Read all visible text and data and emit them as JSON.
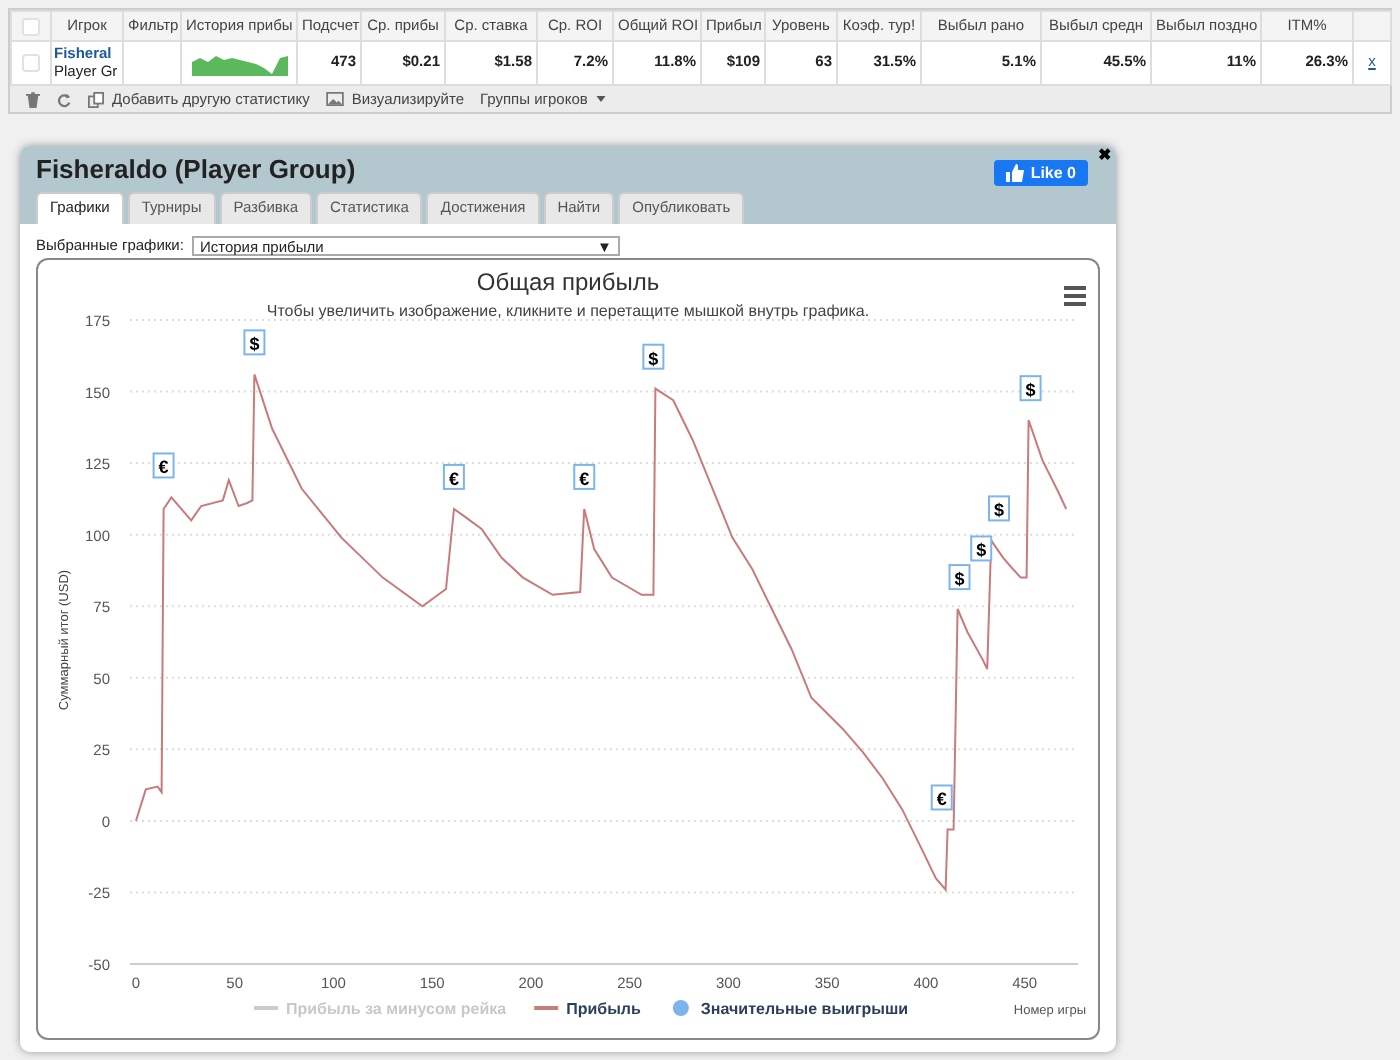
{
  "stats_table": {
    "all_checked": false,
    "columns": [
      "Игрок",
      "Фильтр",
      "История прибы",
      "Подсчет",
      "Ср. прибы",
      "Ср. ставка",
      "Ср. ROI",
      "Общий ROI",
      "Прибыл",
      "Уровень",
      "Коэф. тур!",
      "Выбыл рано",
      "Выбыл средн",
      "Выбыл поздно",
      "ITM%"
    ],
    "rows": [
      {
        "checked": false,
        "player_sub": "Player Gr",
        "cells": [
          "Fisheral",
          "",
          "",
          "473",
          "$0.21",
          "$1.58",
          "7.2%",
          "11.8%",
          "$109",
          "63",
          "31.5%",
          "5.1%",
          "45.5%",
          "11%",
          "26.3%"
        ],
        "remove": "x"
      }
    ],
    "toolbar": [
      "Добавить другую статистику",
      "Визуализируйте",
      "Группы игроков"
    ]
  },
  "dialog": {
    "close": "✖",
    "title": "Fisheraldo (Player Group)",
    "like": "Like 0",
    "tabs": [
      {
        "label": "Графики",
        "selected": true
      },
      {
        "label": "Турниры",
        "selected": false
      },
      {
        "label": "Разбивка",
        "selected": false
      },
      {
        "label": "Статистика",
        "selected": false
      },
      {
        "label": "Достижения",
        "selected": false
      },
      {
        "label": "Найти",
        "selected": false
      },
      {
        "label": "Опубликовать",
        "selected": false
      }
    ],
    "select_label": "Выбранные графики:",
    "select_value": "История прибыли",
    "select_arrow": "▼",
    "chart": {
      "subtitle": "Чтобы увеличить изображение, кликните и перетащите мышкой внутрь графика.",
      "legend": [
        {
          "kind": "hidden",
          "label": "Прибыль за минусом рейка"
        },
        {
          "kind": "markers",
          "label": "Значительные выигрыши",
          "color": "#7cb5ec"
        }
      ],
      "chart_data": {
        "type": "line",
        "title": "Общая прибыль",
        "xlabel": "Номер игры",
        "ylabel": "Суммарный итог (USD)",
        "x": [
          0,
          5,
          11,
          13,
          14,
          18,
          28,
          33,
          44,
          47,
          52,
          56,
          59,
          60,
          69,
          84,
          104,
          125,
          145,
          157,
          161,
          167,
          175,
          185,
          196,
          211,
          225,
          227,
          232,
          241,
          251,
          256,
          262,
          263,
          272,
          282,
          292,
          302,
          312,
          322,
          332,
          342,
          358,
          368,
          378,
          388,
          398,
          405,
          410,
          411,
          414,
          416,
          421,
          429,
          431,
          433,
          439,
          444,
          448,
          451,
          452,
          459,
          467,
          471
        ],
        "series": [
          {
            "name": "Прибыль",
            "color": "#c97a7a",
            "values": [
              0,
              11,
              12,
              10,
              109,
              113,
              105,
              110,
              112,
              119,
              110,
              111,
              112,
              156,
              137,
              116,
              99,
              85,
              75,
              81,
              109,
              106,
              102,
              92,
              85,
              79,
              80,
              109,
              95,
              85,
              81,
              79,
              79,
              151,
              147,
              133,
              116,
              99,
              88,
              74,
              60,
              43,
              32,
              24,
              15,
              4,
              -10,
              -20,
              -24,
              -3,
              -3,
              74,
              66,
              56,
              53,
              98,
              92,
              88,
              85,
              85,
              140,
              126,
              115,
              109
            ]
          }
        ],
        "xlim": [
          -3,
          477
        ],
        "grid": true,
        "ylim": [
          -50,
          175
        ],
        "xticks": [
          0,
          50,
          100,
          150,
          200,
          250,
          300,
          350,
          400,
          450
        ],
        "yticks": [
          -50,
          -25,
          0,
          25,
          50,
          75,
          100,
          125,
          150,
          175
        ],
        "annotations": [
          {
            "x": 14,
            "y": 113,
            "text": "€"
          },
          {
            "x": 60,
            "y": 156,
            "text": "$"
          },
          {
            "x": 161,
            "y": 109,
            "text": "€"
          },
          {
            "x": 227,
            "y": 109,
            "text": "€"
          },
          {
            "x": 262,
            "y": 151,
            "text": "$"
          },
          {
            "x": 408,
            "y": -3,
            "text": "€"
          },
          {
            "x": 417,
            "y": 74,
            "text": "$"
          },
          {
            "x": 428,
            "y": 84,
            "text": "$"
          },
          {
            "x": 437,
            "y": 98,
            "text": "$"
          },
          {
            "x": 453,
            "y": 140,
            "text": "$"
          }
        ]
      }
    }
  }
}
